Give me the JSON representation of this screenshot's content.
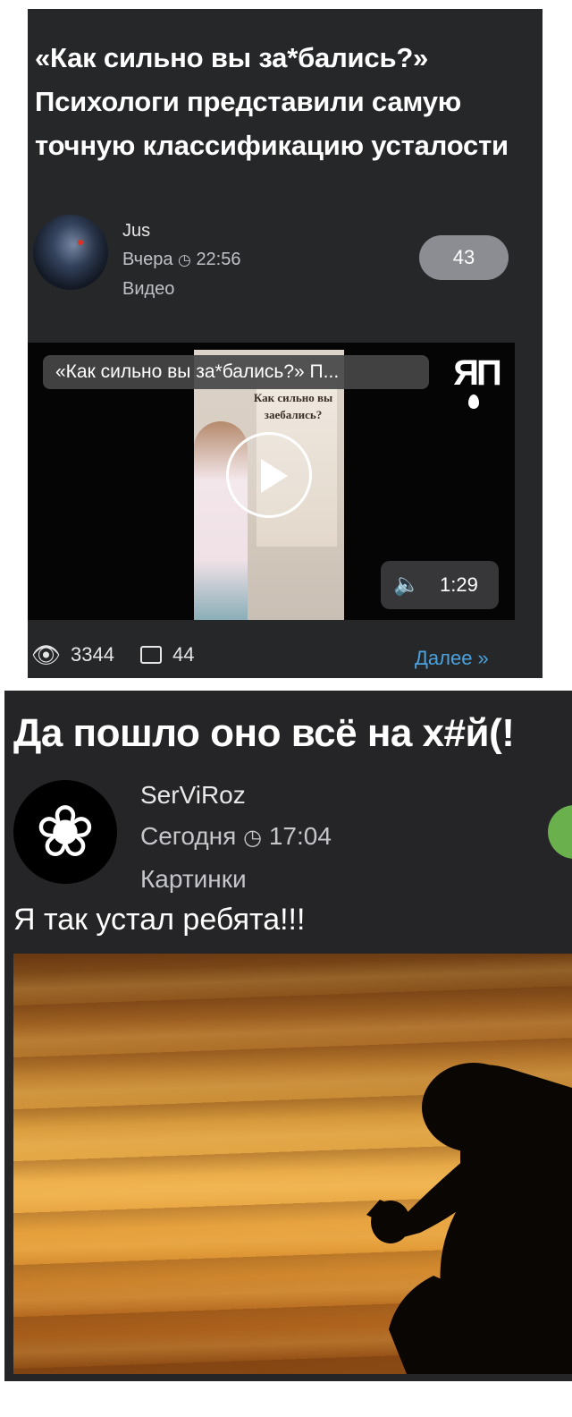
{
  "post1": {
    "title": "«Как сильно вы за*бались?» Психологи представили самую точную классификацию усталости",
    "author": "Jus",
    "date_label": "Вчера",
    "time": "22:56",
    "category": "Видео",
    "rating_badge": "43",
    "video": {
      "caption": "«Как сильно вы за*бались?» П...",
      "frame_text": "Как сильно вы заебались?",
      "logo": "ЯП",
      "duration": "1:29"
    },
    "views": "3344",
    "comments": "44",
    "more_link": "Далее »"
  },
  "post2": {
    "title": "Да пошло оно всё на х#й(!",
    "author": "SerViRoz",
    "date_label": "Сегодня",
    "time": "17:04",
    "category": "Картинки",
    "body_text": "Я так устал ребята!!!"
  },
  "icons": {
    "clock": "clock-icon",
    "eye": "eye-icon",
    "comment": "comment-icon",
    "play": "play-icon",
    "speaker": "speaker-icon"
  },
  "colors": {
    "card_bg": "#262729",
    "badge": "#8b8d92",
    "link": "#4aa3df",
    "badge_green": "#6ab04c"
  }
}
